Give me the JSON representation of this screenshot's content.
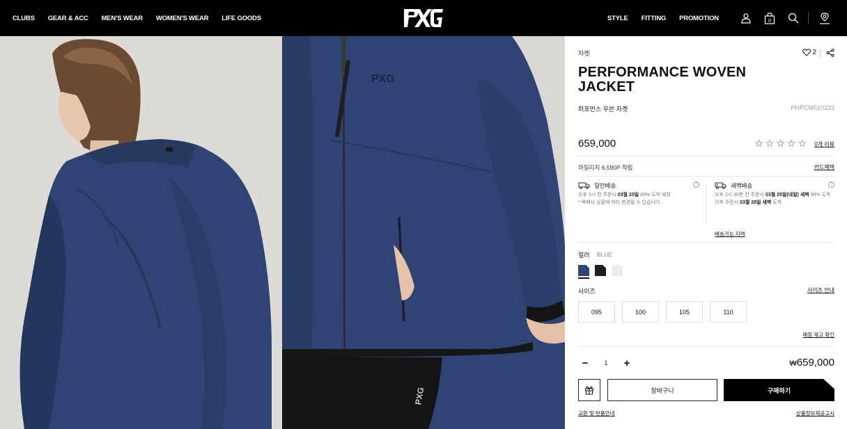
{
  "header": {
    "nav_left": [
      "CLUBS",
      "GEAR & ACC",
      "MEN'S WEAR",
      "WOMEN'S WEAR",
      "LIFE GOODS"
    ],
    "nav_right": [
      "STYLE",
      "FITTING",
      "PROMOTION"
    ],
    "icons": [
      "user-icon",
      "bag-icon",
      "search-icon",
      "store-locator-icon"
    ],
    "bag_count": "0"
  },
  "product": {
    "category": "자켓",
    "like_count": "2",
    "title": "PERFORMANCE WOVEN JACKET",
    "name_ko": "퍼포먼스 우븐 자켓",
    "code": "PHPCM610233",
    "price": "659,000",
    "review_link": "0개 리뷰",
    "rating": 0,
    "mileage": "마일리지 6,590P 적립",
    "card_benefit": "카드혜택"
  },
  "delivery": {
    "standard": {
      "title": "일반배송",
      "line1_pre": "오후 3시 전 주문시 ",
      "line1_bold": "03월 25일",
      "line1_post": " 89% 도착 예정",
      "line2": "* 택배사 상황에 따라 변경될 수 있습니다."
    },
    "dawn": {
      "title": "새벽배송",
      "line1_pre": "오후 2시 30분 전 주문시 ",
      "line1_bold": "03월 25일(내일) 새벽",
      "line1_post": " 98% 도착",
      "line2_pre": "이후 주문시 ",
      "line2_bold": "03월 28일 새벽",
      "line2_post": " 도착"
    },
    "area_link": "배송가능 지역"
  },
  "options": {
    "color_label": "컬러",
    "color_value": "BLUE",
    "swatches": [
      "#2f4474",
      "#1e1e1e",
      "#ececec"
    ],
    "size_label": "사이즈",
    "size_guide": "사이즈 안내",
    "sizes": [
      "095",
      "100",
      "105",
      "110"
    ],
    "stock_link": "매장 재고 확인"
  },
  "purchase": {
    "quantity": "1",
    "currency": "₩",
    "total": "659,000",
    "cart_label": "장바구니",
    "buy_label": "구매하기",
    "exchange_link": "교환 및 반품안내",
    "notice_link": "상품정보제공고시"
  },
  "colors": {
    "header_bg": "#000000",
    "jacket": "#2f4474"
  }
}
